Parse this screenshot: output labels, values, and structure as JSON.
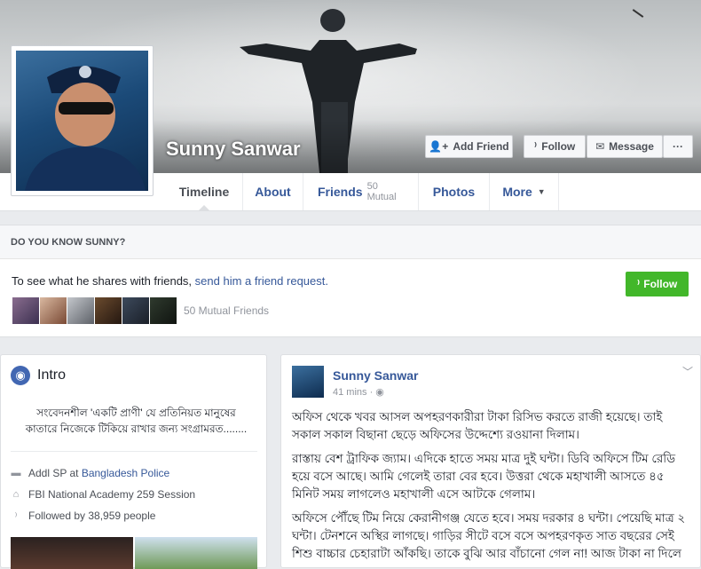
{
  "profile": {
    "name": "Sunny Sanwar"
  },
  "actions": {
    "add_friend": "Add Friend",
    "follow": "Follow",
    "message": "Message",
    "more": "···"
  },
  "tabs": [
    {
      "label": "Timeline",
      "sub": ""
    },
    {
      "label": "About",
      "sub": ""
    },
    {
      "label": "Friends",
      "sub": "50 Mutual"
    },
    {
      "label": "Photos",
      "sub": ""
    },
    {
      "label": "More",
      "sub": ""
    }
  ],
  "know": {
    "header": "DO YOU KNOW SUNNY?",
    "desc_prefix": "To see what he shares with friends, ",
    "desc_link": "send him a friend request.",
    "follow_label": "Follow",
    "mutual_friends": "50 Mutual Friends"
  },
  "intro": {
    "title": "Intro",
    "bio": "সংবেদনশীল 'একটি প্রাণী' যে প্রতিনিয়ত মানুষের কাতারে নিজেকে টিকিয়ে রাখার জন্য সংগ্রামরত........",
    "work_prefix": "Addl SP at ",
    "work_link": "Bangladesh Police",
    "education": "FBI National Academy 259 Session",
    "followers_prefix": "Followed by ",
    "followers_count": "38,959 people"
  },
  "post": {
    "author": "Sunny Sanwar",
    "time": "41 mins · ",
    "paragraphs": [
      "অফিস থেকে খবর আসল অপহরণকারীরা টাকা রিসিভ করতে রাজী হয়েছে। তাই সকাল সকাল বিছানা ছেড়ে অফিসের উদ্দেশ্যে রওয়ানা দিলাম।",
      "রাস্তায় বেশ ট্রাফিক জ্যাম। এদিকে হাতে সময় মাত্র দুই ঘন্টা। ডিবি অফিসে টিম রেডি হয়ে বসে আছে। আমি গেলেই তারা বের হবে। উত্তরা থেকে মহাখালী আসতে ৪৫ মিনিট সময় লাগলেও মহাখালী এসে আটকে গেলাম।",
      "অফিসে পৌঁছে টিম নিয়ে কেরানীগঞ্জ যেতে হবে। সময় দরকার ৪ ঘন্টা। পেয়েছি মাত্র ২ ঘন্টা। টেনশনে অস্থির লাগছে। গাড়ির সীটে বসে বসে অপহরণকৃত সাত বছরের সেই শিশু বাচ্চার চেহারাটা আঁকছি। তাকে বুঝি আর বাঁচানো গেল না! আজ টাকা না দিলে"
    ]
  },
  "colors": {
    "link": "#365899",
    "green": "#42b72a",
    "background": "#e9ebee"
  }
}
